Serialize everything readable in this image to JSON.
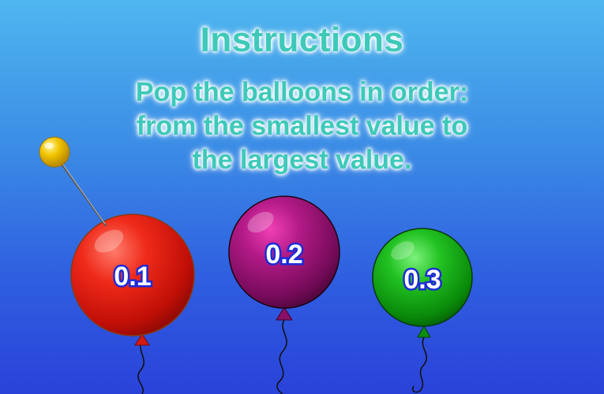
{
  "game": {
    "title": "Instructions",
    "instructions": [
      "Pop the balloons in order:",
      "from the smallest value to",
      "the largest value."
    ]
  },
  "balloons": [
    {
      "label": "0.1",
      "color": "red"
    },
    {
      "label": "0.2",
      "color": "purple"
    },
    {
      "label": "0.3",
      "color": "green"
    }
  ],
  "colors": {
    "text": "#3ec9b9",
    "label_outline": "#1d2bd8",
    "pin_head": "#f2c400"
  }
}
